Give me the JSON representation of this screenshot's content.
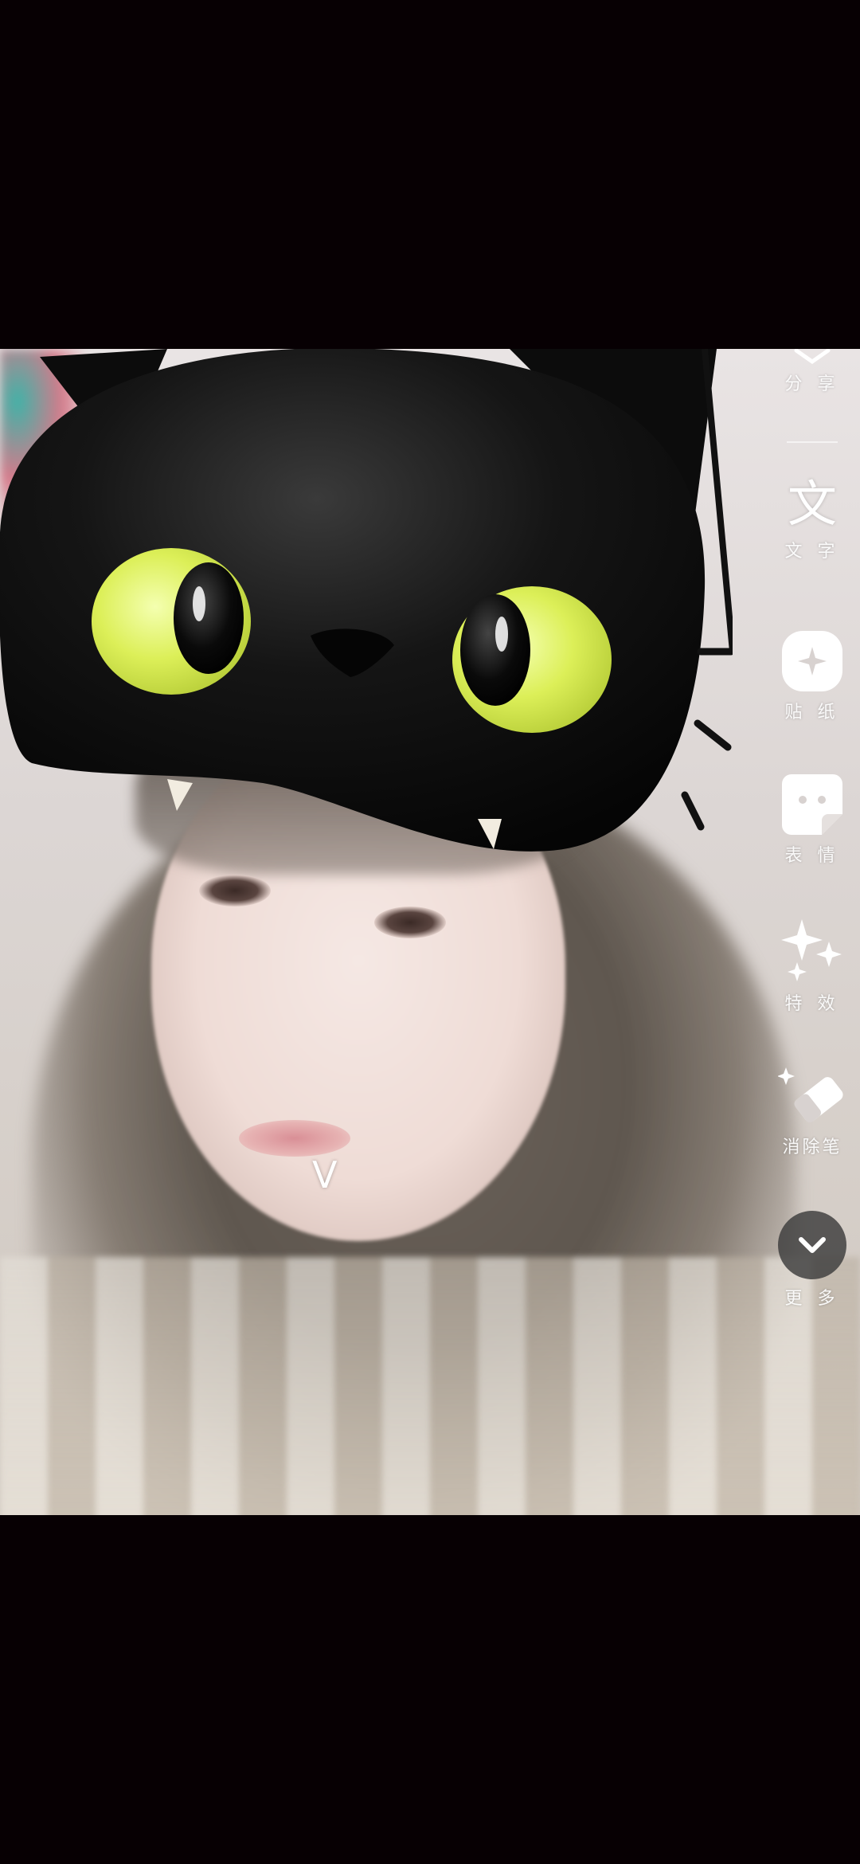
{
  "caption": {
    "text": "V"
  },
  "tools": {
    "items": [
      {
        "name": "split",
        "label": "分 享",
        "icon": "share-icon"
      },
      {
        "name": "text",
        "glyph": "文",
        "label": "文 字",
        "icon": "text-icon"
      },
      {
        "name": "effects",
        "label": "贴 纸",
        "icon": "sticker-icon"
      },
      {
        "name": "sticker",
        "label": "表 情",
        "icon": "emoji-sticker-icon"
      },
      {
        "name": "sparkle",
        "label": "特 效",
        "icon": "sparkle-icon"
      },
      {
        "name": "eraser",
        "label": "消除笔",
        "icon": "eraser-icon"
      },
      {
        "name": "more",
        "label": "更 多",
        "icon": "chevron-down-icon"
      }
    ]
  },
  "colors": {
    "letterbox": "#070003",
    "cat_eye": "#d9ef5a",
    "more_button": "#3c3c3c"
  }
}
